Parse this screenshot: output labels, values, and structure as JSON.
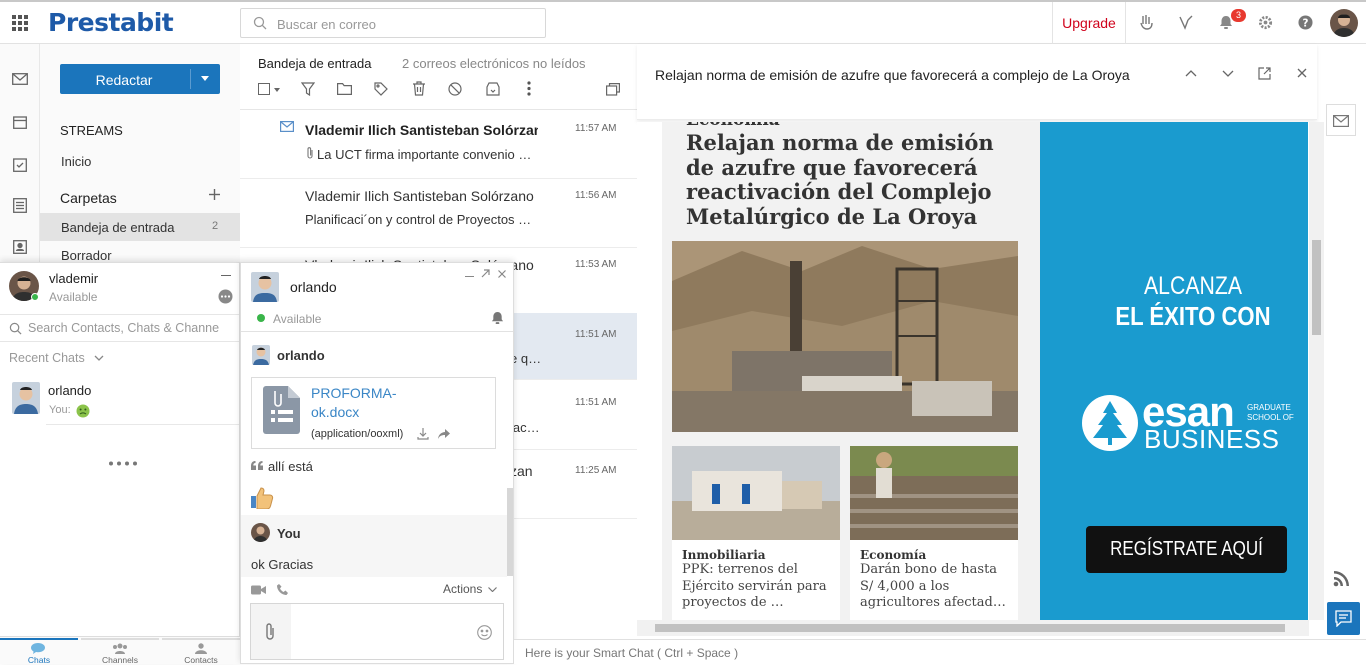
{
  "topbar": {
    "logo": "Prestabit",
    "search_placeholder": "Buscar en correo",
    "upgrade": "Upgrade",
    "notification_count": "3"
  },
  "nav": {
    "compose": "Redactar",
    "streams": "STREAMS",
    "inicio": "Inicio",
    "folders": "Carpetas",
    "inbox": "Bandeja de entrada",
    "inbox_count": "2",
    "drafts": "Borrador"
  },
  "list": {
    "folder": "Bandeja de entrada",
    "unread": "2 correos electrónicos no leídos",
    "rows": [
      {
        "from": "Vlademir Ilich Santisteban Solórzano",
        "subject": "La UCT firma importante convenio …",
        "time": "11:57 AM"
      },
      {
        "from": "Vlademir Ilich Santisteban Solórzano",
        "subject": "Planificaci´on y control de Proyectos …",
        "time": "11:56 AM"
      },
      {
        "from": "Vlademir Ilich Santisteban Solórzano",
        "subject": "",
        "time": "11:53 AM"
      },
      {
        "from": "",
        "subject": "e q…",
        "time": "11:51 AM"
      },
      {
        "from": "",
        "subject": "lac…",
        "time": "11:51 AM"
      },
      {
        "from": "zan",
        "subject": "",
        "time": "11:25 AM"
      }
    ]
  },
  "reader": {
    "title": "Relajan norma de emisión de azufre que favorecerá a complejo de La Oroya",
    "section": "Economía",
    "headline": "Relajan norma de emisión de azufre que favorecerá reactivación del Complejo Metalúrgico de La Oroya",
    "card1": {
      "section": "Inmobiliaria",
      "text": "PPK: terrenos del Ejército servirán para proyectos de …"
    },
    "card2": {
      "section": "Economía",
      "text": "Darán bono de hasta S/ 4,000 a los agricultores afectad…"
    },
    "ad": {
      "line1": "ALCANZA",
      "line2": "EL ÉXITO CON",
      "brand": "esan",
      "brand_small1": "GRADUATE",
      "brand_small2": "SCHOOL OF",
      "business": "BUSINESS",
      "cta": "REGÍSTRATE AQUÍ"
    }
  },
  "chat": {
    "user": "vlademir",
    "status": "Available",
    "search_placeholder": "Search Contacts, Chats & Channe",
    "recent": "Recent Chats",
    "contact_name": "orlando",
    "contact_preview": "You:",
    "tabs": [
      "Chats",
      "Channels",
      "Contacts"
    ]
  },
  "conv": {
    "name": "orlando",
    "status": "Available",
    "sender1": "orlando",
    "file_name": "PROFORMA-ok.docx",
    "file_line1": "PROFORMA-",
    "file_line2": "ok.docx",
    "file_type": "(application/ooxml)",
    "quote": "allí está",
    "sender2": "You",
    "message": "ok Gracias",
    "actions": "Actions"
  },
  "smartbar": "Here is your Smart Chat ( Ctrl + Space )"
}
